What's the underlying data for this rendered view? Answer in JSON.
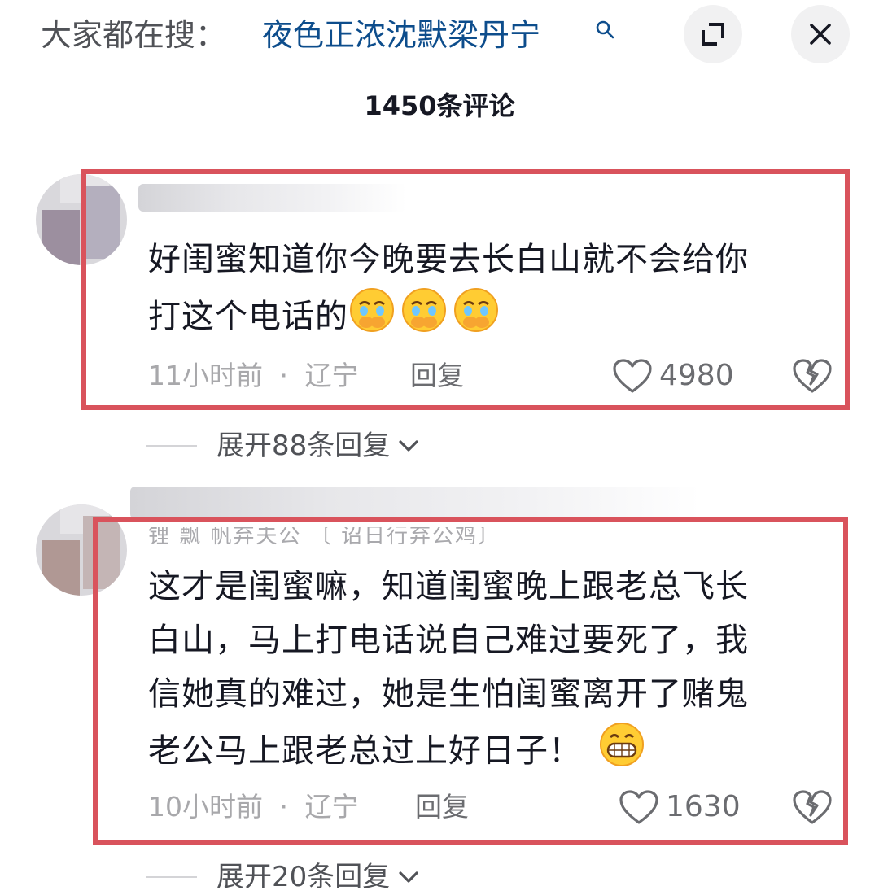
{
  "header": {
    "search_prefix": "大家都在搜：",
    "search_term": "夜色正浓沈默梁丹宁",
    "icons": {
      "search_term": "search-icon",
      "expand": "expand-icon",
      "close": "close-icon"
    },
    "comment_count": "1450条评论"
  },
  "colors": {
    "search_term": "#0d4d8c",
    "highlight": "#d9535c",
    "text": "#161823",
    "meta": "#a8a8ab"
  },
  "comments": [
    {
      "text_line1": "好闺蜜知道你今晚要去长白山就不会给你",
      "text_line2": "打这个电话的",
      "emojis": [
        "crying-emoji",
        "crying-emoji",
        "crying-emoji"
      ],
      "time": "11小时前",
      "location": "辽宁",
      "separator": "·",
      "reply_label": "回复",
      "likes": "4980",
      "expand_label": "展开88条回复"
    },
    {
      "username_partial": "锂  飘    帆弃夫公     〔  诏日行弃公鸡〕",
      "text_lines": [
        "这才是闺蜜嘛，知道闺蜜晚上跟老总飞长",
        "白山，马上打电话说自己难过要死了，我",
        "信她真的难过，她是生怕闺蜜离开了赌鬼",
        "老公马上跟老总过上好日子！"
      ],
      "emojis": [
        "grinning-emoji"
      ],
      "time": "10小时前",
      "location": "辽宁",
      "separator": "·",
      "reply_label": "回复",
      "likes": "1630",
      "expand_label": "展开20条回复"
    }
  ]
}
